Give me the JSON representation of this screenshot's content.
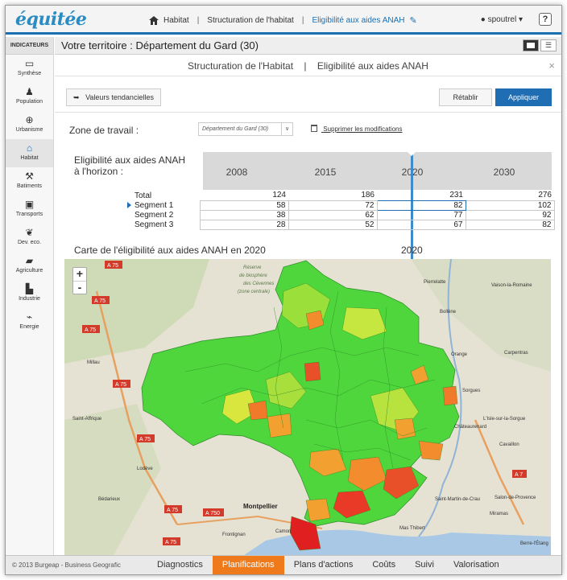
{
  "app": {
    "logo": "équitée"
  },
  "nav": {
    "items": [
      "Habitat",
      "Structuration de l'habitat",
      "Eligibilité aux aides ANAH"
    ]
  },
  "user": {
    "name": "spoutrel"
  },
  "help": "?",
  "sidebar": {
    "header": "INDICATEURS",
    "items": [
      {
        "label": "Synthèse",
        "icon": "synthese-icon"
      },
      {
        "label": "Population",
        "icon": "population-icon"
      },
      {
        "label": "Urbanisme",
        "icon": "urbanisme-icon"
      },
      {
        "label": "Habitat",
        "icon": "home-icon"
      },
      {
        "label": "Batiments",
        "icon": "batiments-icon"
      },
      {
        "label": "Transports",
        "icon": "bus-icon"
      },
      {
        "label": "Dev. eco.",
        "icon": "leaf-icon"
      },
      {
        "label": "Agriculture",
        "icon": "tractor-icon"
      },
      {
        "label": "Industrie",
        "icon": "factory-icon"
      },
      {
        "label": "Energie",
        "icon": "energy-icon"
      }
    ]
  },
  "territory": "Votre territoire : Département du Gard (30)",
  "panel": {
    "title_left": "Structuration de l'Habitat",
    "title_sep": "|",
    "title_right": "Eligibilité aux aides ANAH",
    "close": "×"
  },
  "toolbar": {
    "back": "Valeurs tendancielles",
    "reset": "Rétablir",
    "apply": "Appliquer"
  },
  "zone": {
    "label": "Zone de travail :",
    "value": "Département du Gard (30)",
    "delete": "Supprimer les modifications"
  },
  "eligibility": {
    "label_line1": "Eligibilité aux aides ANAH",
    "label_line2": "à l'horizon :",
    "years": [
      "2008",
      "2015",
      "2020",
      "2030"
    ],
    "rows": [
      {
        "name": "Total",
        "values": [
          "124",
          "186",
          "231",
          "276"
        ]
      },
      {
        "name": "Segment 1",
        "values": [
          "58",
          "72",
          "82",
          "102"
        ]
      },
      {
        "name": "Segment 2",
        "values": [
          "38",
          "62",
          "77",
          "92"
        ]
      },
      {
        "name": "Segment 3",
        "values": [
          "28",
          "52",
          "67",
          "82"
        ]
      }
    ]
  },
  "map": {
    "title": "Carte de l'éligibilité aux aides ANAH en 2020",
    "year": "2020",
    "zoom_in": "+",
    "zoom_out": "-",
    "labels": [
      "Réserve de biosphère des Cévennes (zone centrale)",
      "Pierrelatte",
      "Vaison-la-Romaine",
      "Bollène",
      "Orange",
      "Carpentras",
      "Sorgues",
      "L'Isle-sur-la-Sorgue",
      "Châteaurenard",
      "Cavaillon",
      "Salon-de-Provence",
      "Miramas",
      "Saint-Martin-de-Crau",
      "Montpellier",
      "Lodève",
      "Bédarieux",
      "Millau",
      "Frontignan",
      "Camon",
      "Mas Thibert",
      "Berre-l'Étang",
      "Saint-Affrique"
    ],
    "roads": [
      "A 75",
      "A 750",
      "A 7"
    ]
  },
  "footer": {
    "copyright": "© 2013 Burgeap - Business Geografic",
    "tabs": [
      "Diagnostics",
      "Planifications",
      "Plans d'actions",
      "Coûts",
      "Suivi",
      "Valorisation"
    ]
  },
  "colors": {
    "accent": "#1f6eb3",
    "active_tab": "#ee7a1c",
    "map_green": "#3cd63c",
    "map_red": "#e02020"
  }
}
